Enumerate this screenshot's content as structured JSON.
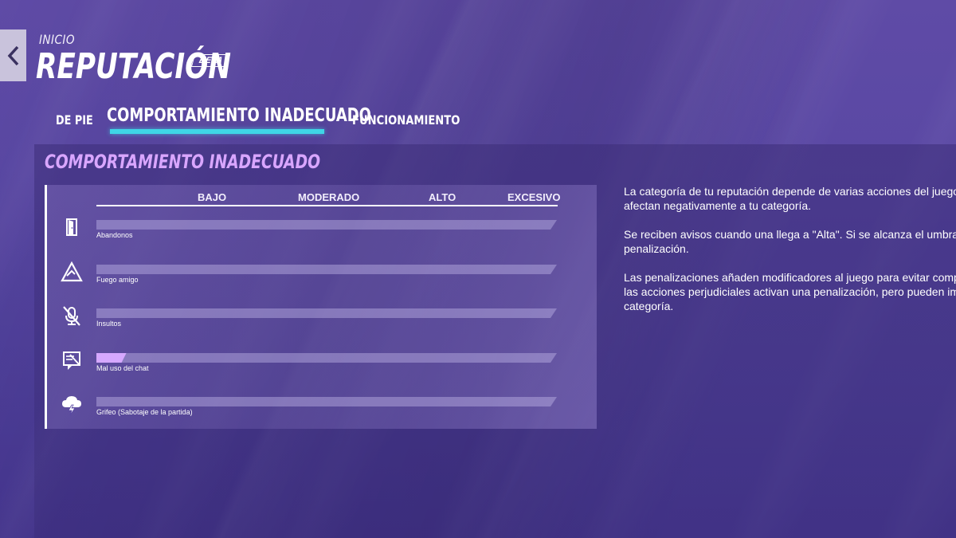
{
  "header": {
    "breadcrumb": "INICIO",
    "title": "REPUTACIÓN",
    "badge": "BETA"
  },
  "tabs": [
    {
      "label": "DE PIE",
      "active": false
    },
    {
      "label": "COMPORTAMIENTO INADECUADO",
      "active": true
    },
    {
      "label": "FUNCIONAMIENTO",
      "active": false
    }
  ],
  "section": {
    "title": "COMPORTAMIENTO INADECUADO"
  },
  "levels": [
    "BAJO",
    "MODERADO",
    "ALTO",
    "EXCESIVO"
  ],
  "rows": [
    {
      "label": "Abandonos",
      "icon": "door-icon",
      "fill_fraction": 0
    },
    {
      "label": "Fuego amigo",
      "icon": "triangle-icon",
      "fill_fraction": 0
    },
    {
      "label": "Insultos",
      "icon": "muted-mic-icon",
      "fill_fraction": 0
    },
    {
      "label": "Mal uso del chat",
      "icon": "chat-flag-icon",
      "fill_fraction": 0.065
    },
    {
      "label": "Grifeo (Sabotaje de la partida)",
      "icon": "storm-cloud-icon",
      "fill_fraction": 0
    }
  ],
  "description": {
    "p1_line1": "La categoría de tu reputación depende de varias acciones del juego",
    "p1_line2": "afectan negativamente a tu categoría.",
    "p2_line1": "Se reciben avisos cuando una llega a \"Alta\". Si se alcanza el umbra",
    "p2_line2": "penalización.",
    "p3_line1": "Las penalizaciones añaden modificadores al juego para evitar comp",
    "p3_line2": "las acciones perjudiciales activan una penalización, pero pueden im",
    "p3_line3": "categoría."
  },
  "colors": {
    "accent_underline": "#3fd6e6",
    "section_title": "#d9a6ff",
    "bar_fill": "#d6a8ff"
  }
}
